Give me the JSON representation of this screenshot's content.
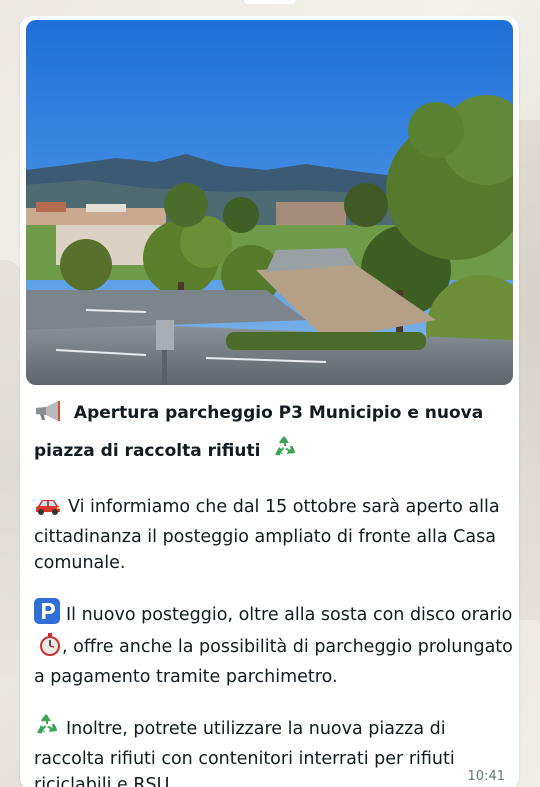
{
  "message": {
    "title_line1": "Apertura parcheggio P3 Municipio e nuova",
    "title_line2": "piazza di raccolta rifiuti",
    "para1": "Vi informiamo che dal 15 ottobre sarà aperto alla cittadinanza il posteggio ampliato di fronte alla Casa comunale.",
    "para2_a": "Il nuovo posteggio, oltre alla sosta con disco orario",
    "para2_b": ", offre anche la possibilità di parcheggio prolungato a pagamento tramite parchimetro.",
    "para3": "Inoltre, potrete utilizzare la nuova piazza di raccolta rifiuti con contenitori interrati per rifiuti riciclabili e RSU.",
    "time": "10:41"
  },
  "icons": {
    "megaphone": "megaphone-icon",
    "recycle": "recycle-icon",
    "car": "car-icon",
    "parking": "parking-icon",
    "stopwatch": "stopwatch-icon"
  },
  "colors": {
    "bubble": "#ffffff",
    "text": "#111b21",
    "timestamp": "#667781",
    "recycle_green": "#3aa655",
    "parking_blue": "#2f6fd6",
    "car_red": "#d9362e"
  }
}
